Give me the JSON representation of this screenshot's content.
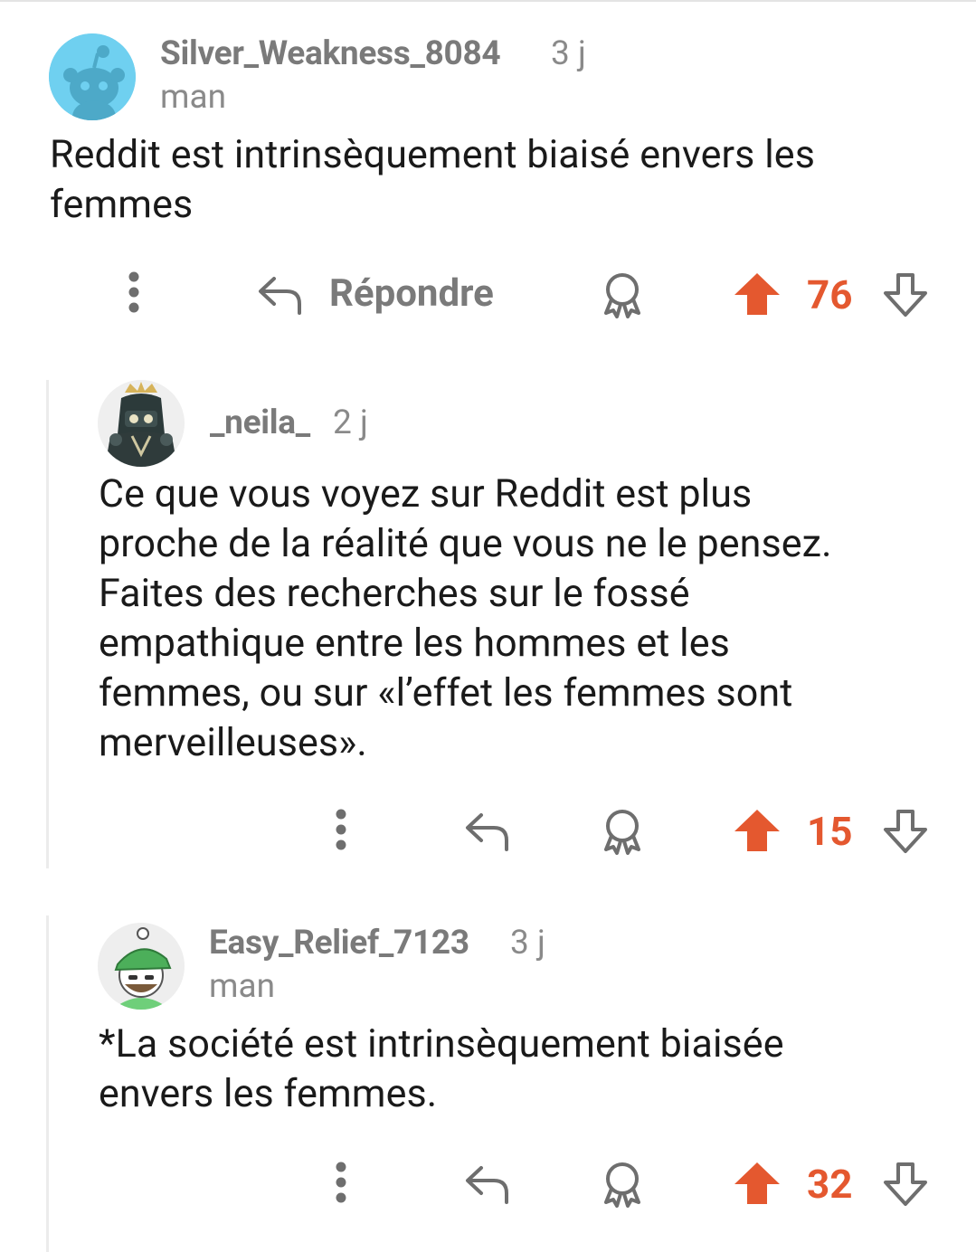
{
  "comments": [
    {
      "username": "Silver_Weakness_8084",
      "age": "3 j",
      "flair": "man",
      "text": "Reddit est intrinsèquement biaisé envers les\nfemmes",
      "reply_label": "Répondre",
      "score": "76",
      "avatar": "snoo-avatar-icon"
    },
    {
      "username": "_neila_",
      "age": "2 j",
      "text": "Ce que vous voyez sur Reddit est plus\nproche de la réalité que vous ne le pensez.\nFaites des recherches sur le fossé\nempathique entre les hommes et les\nfemmes, ou sur «l’effet les femmes sont\nmerveilleuses».",
      "score": "15",
      "avatar": "armored-knight-avatar-icon"
    },
    {
      "username": "Easy_Relief_7123",
      "age": "3 j",
      "flair": "man",
      "text": "*La société est intrinsèquement biaisée\nenvers les femmes.",
      "score": "32",
      "avatar": "green-cap-avatar-icon"
    }
  ],
  "colors": {
    "upvote_accent": "#e4582f",
    "icon_gray": "#6e6e6e",
    "avatar_blue": "#6fd0f0"
  }
}
